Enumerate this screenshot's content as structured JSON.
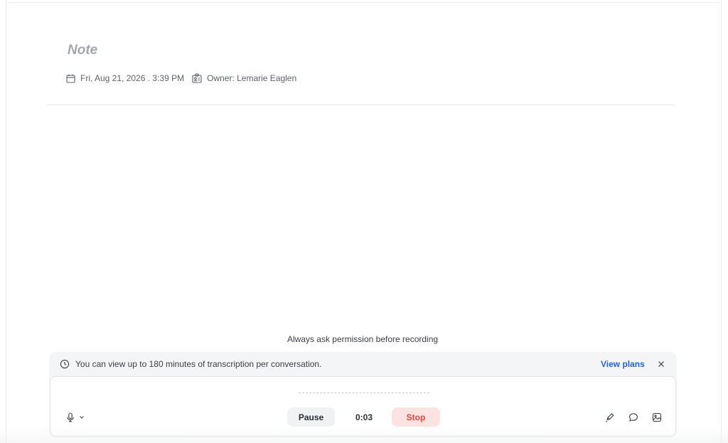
{
  "note": {
    "title": "Note",
    "date": "Fri, Aug 21, 2026 . 3:39 PM",
    "owner": "Owner: Lemarie Eaglen"
  },
  "recorder": {
    "permission_text": "Always ask permission before recording",
    "banner_text": "You can view up to 180 minutes of transcription per conversation.",
    "view_plans_label": "View plans",
    "pause_label": "Pause",
    "timer": "0:03",
    "stop_label": "Stop"
  },
  "icons": {
    "date": "calendar-icon",
    "owner": "id-badge-icon",
    "banner_info": "clock-icon",
    "banner_close": "close-icon",
    "mic": "microphone-icon",
    "mic_menu": "chevron-down-icon",
    "tool_1": "pen-icon",
    "tool_2": "comment-icon",
    "tool_3": "image-icon"
  },
  "colors": {
    "link": "#2563d9",
    "stop": "#e0453a",
    "stop_bg": "#fde2e2",
    "title": "#a3a7ad"
  }
}
